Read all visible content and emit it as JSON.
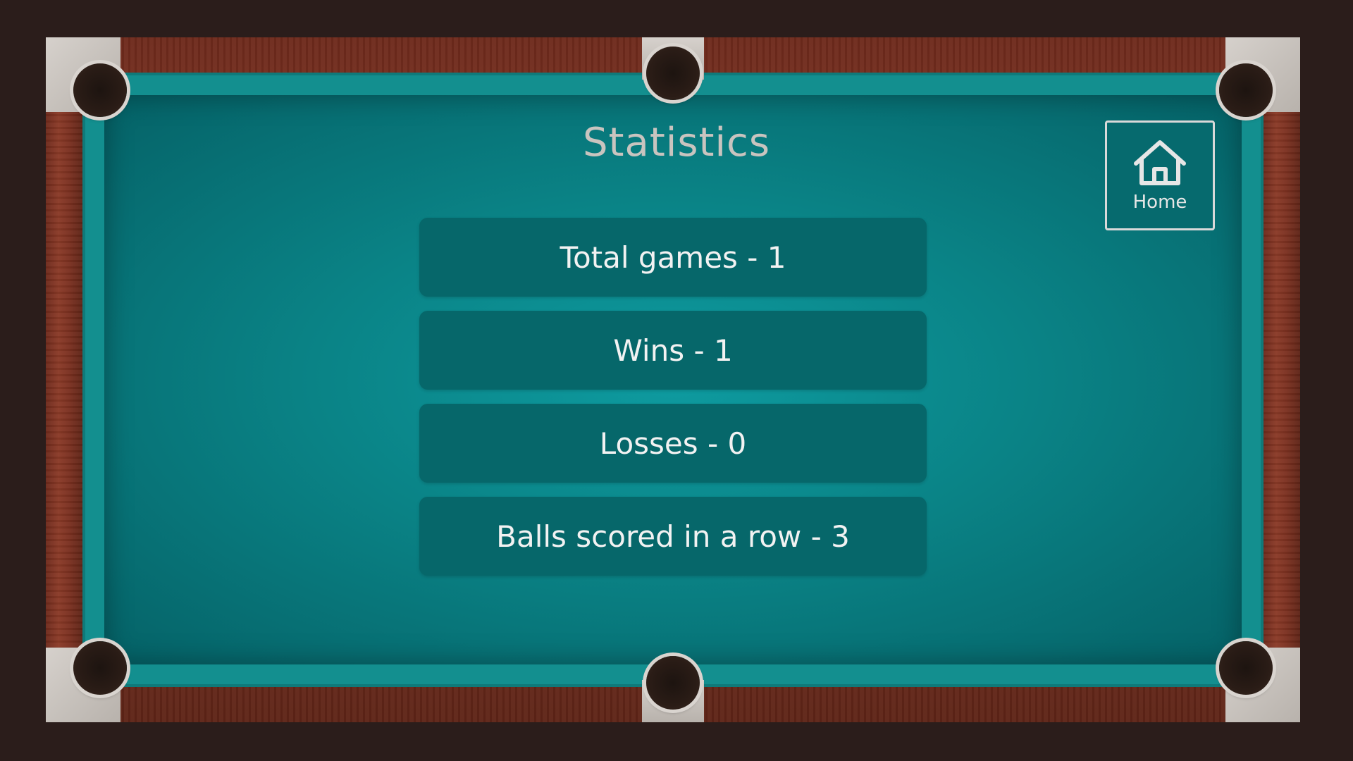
{
  "screen": {
    "title": "Statistics"
  },
  "stats": [
    {
      "label": "Total games - 1"
    },
    {
      "label": "Wins - 1"
    },
    {
      "label": "Losses - 0"
    },
    {
      "label": "Balls scored in a row - 3"
    }
  ],
  "home_button": {
    "label": "Home",
    "icon": "home-icon"
  },
  "colors": {
    "felt": "#0a8386",
    "stat_row": "#06676a",
    "wood": "#7a3020",
    "background": "#2b1d1b"
  }
}
